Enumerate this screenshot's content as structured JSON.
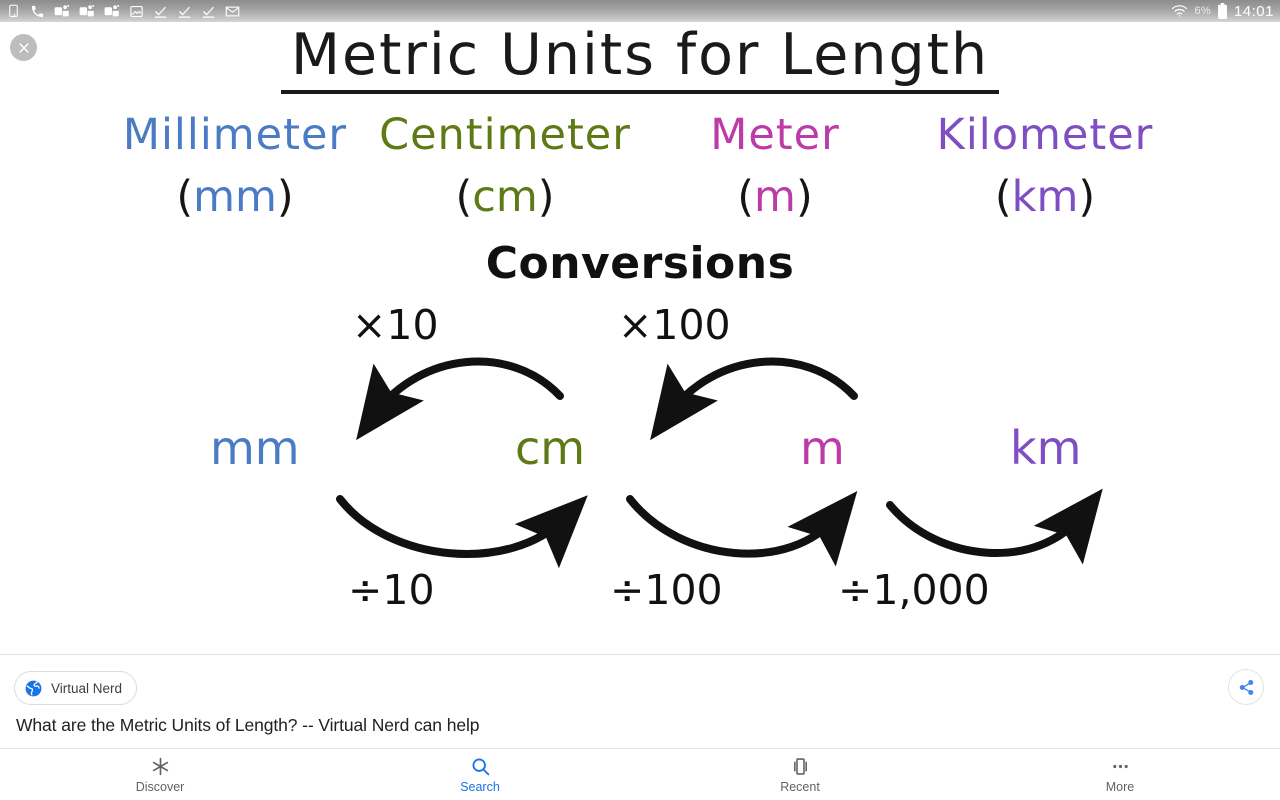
{
  "status_bar": {
    "left_icons": [
      "phone-vibrate-icon",
      "phone-call-icon",
      "teams-icon",
      "teams-icon",
      "teams-icon",
      "image-icon",
      "checkmark-icon",
      "checkmark-icon",
      "checkmark-icon",
      "mail-icon"
    ],
    "wifi_icon": "wifi-icon",
    "battery_percent": "6%",
    "battery_icon": "battery-icon",
    "clock": "14:01"
  },
  "viewer": {
    "close_icon": "close-icon"
  },
  "poster": {
    "title": "Metric Units for Length",
    "units": [
      {
        "name": "Millimeter",
        "abbr": "mm",
        "color": "#4b7bc4"
      },
      {
        "name": "Centimeter",
        "abbr": "cm",
        "color": "#5d7a15"
      },
      {
        "name": "Meter",
        "abbr": "m",
        "color": "#bd3ba8"
      },
      {
        "name": "Kilometer",
        "abbr": "km",
        "color": "#7e4ec2"
      }
    ],
    "paren_open": "(",
    "paren_close": ")",
    "conversions_heading": "Conversions",
    "multiply_labels": [
      "×10",
      "×100"
    ],
    "divide_labels": [
      "÷10",
      "÷100",
      "÷1,000"
    ],
    "diagram_units": [
      "mm",
      "cm",
      "m",
      "km"
    ]
  },
  "source_bar": {
    "chip_icon": "globe-icon",
    "chip_label": "Virtual Nerd",
    "share_icon": "share-icon",
    "caption": "What are the Metric Units of Length? -- Virtual Nerd can help"
  },
  "bottom_nav": {
    "items": [
      {
        "label": "Discover",
        "icon": "asterisk-icon",
        "active": false
      },
      {
        "label": "Search",
        "icon": "search-icon",
        "active": true
      },
      {
        "label": "Recent",
        "icon": "cards-icon",
        "active": false
      },
      {
        "label": "More",
        "icon": "ellipsis-icon",
        "active": false
      }
    ]
  }
}
